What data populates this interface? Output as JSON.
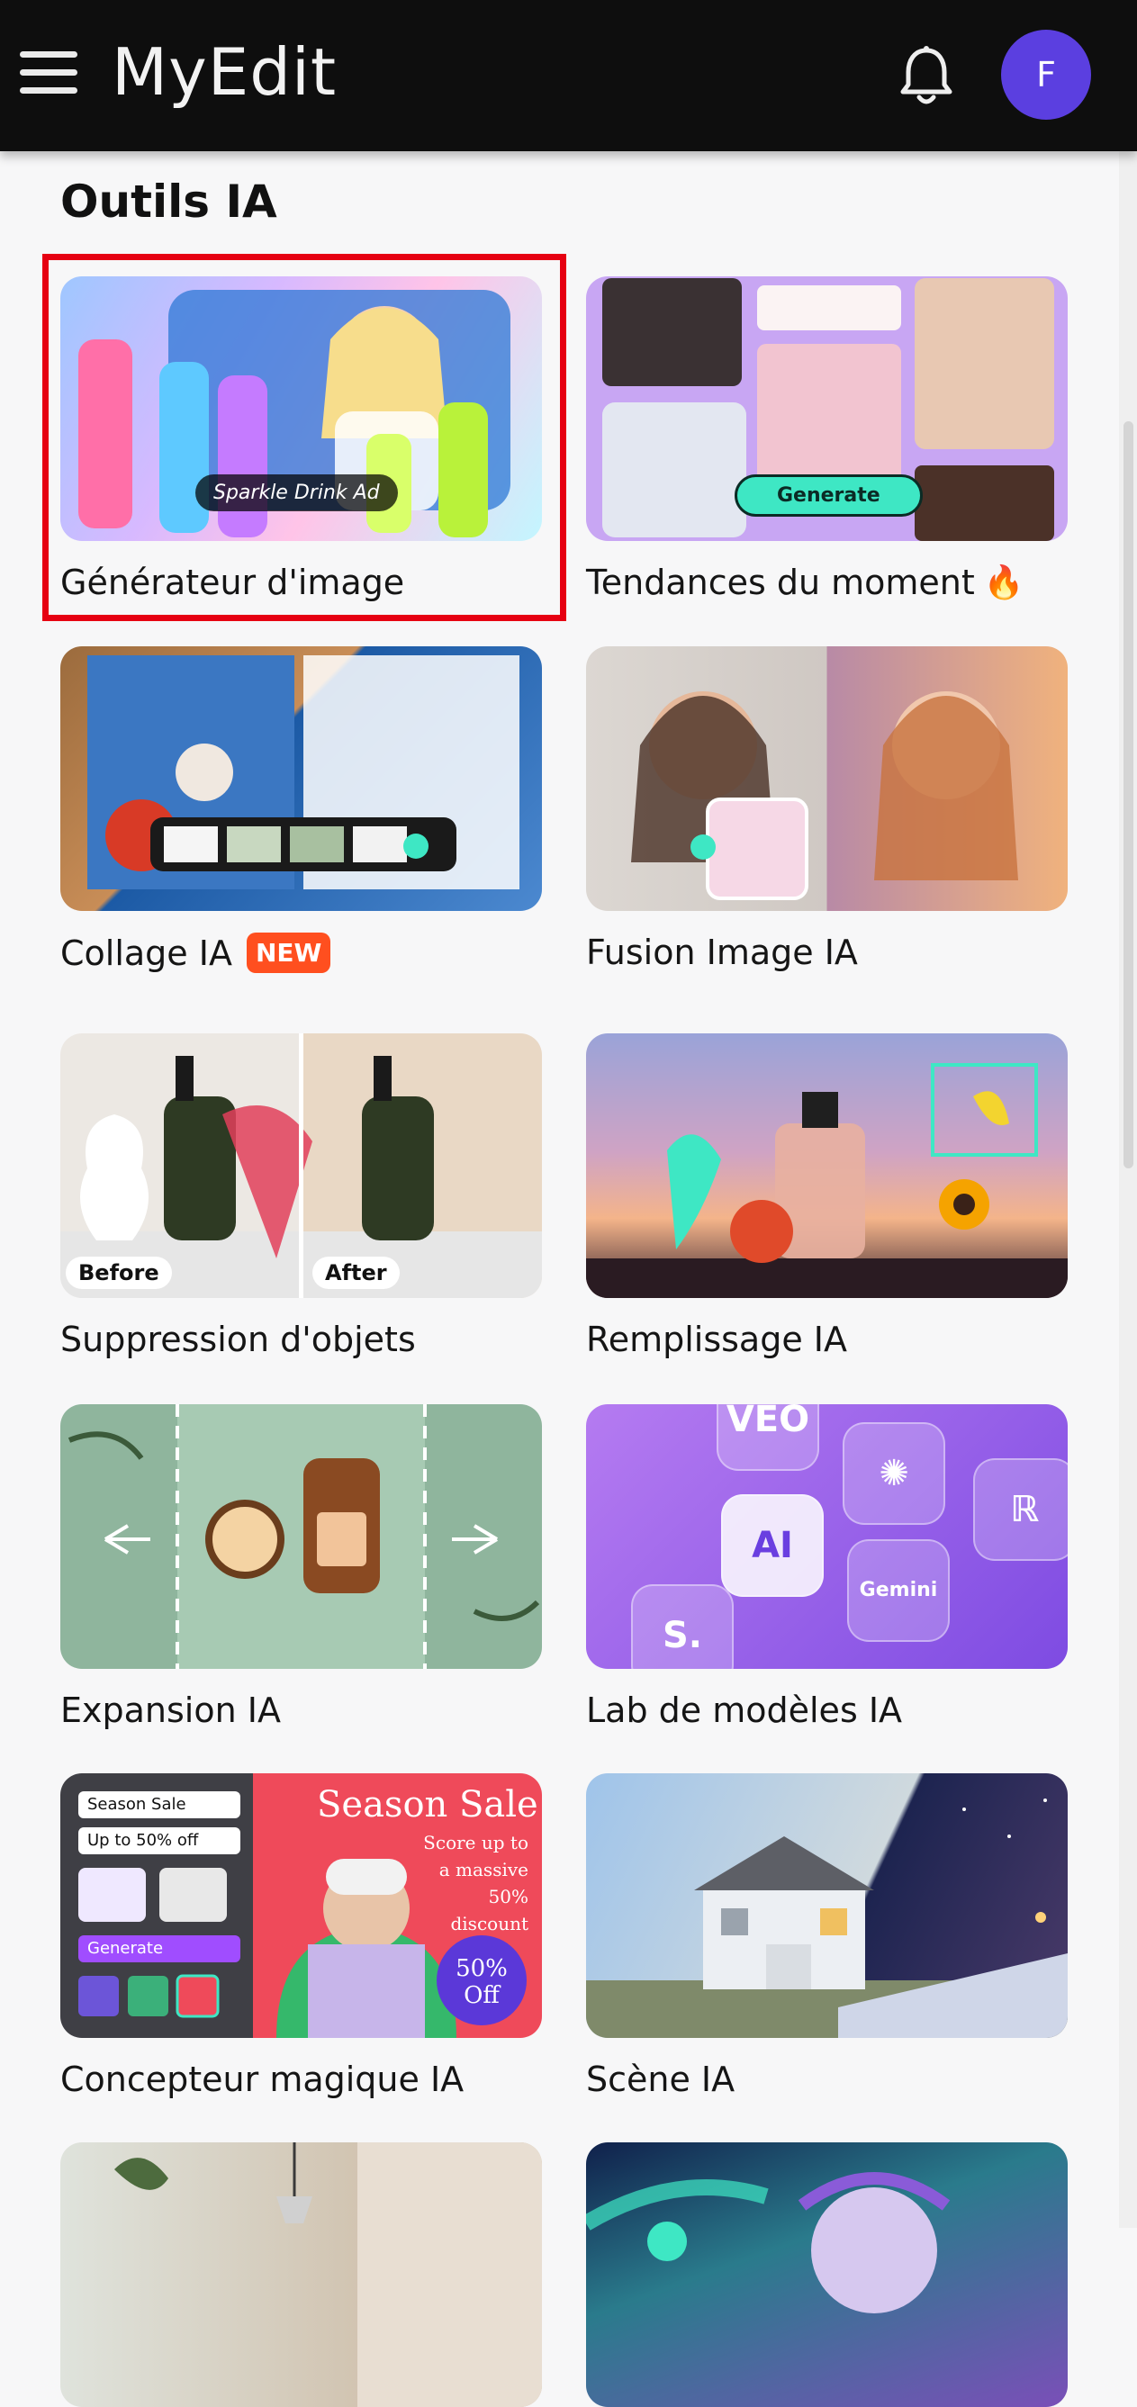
{
  "header": {
    "app_name": "MyEdit",
    "avatar_initial": "F",
    "menu_icon": "hamburger-menu-icon",
    "notification_icon": "bell-icon"
  },
  "section": {
    "title": "Outils IA"
  },
  "cards": [
    {
      "label": "Générateur d'image",
      "overlay": "Sparkle Drink Ad"
    },
    {
      "label": "Tendances du moment",
      "overlay": "Generate",
      "emoji": "🔥"
    },
    {
      "label": "Collage IA",
      "badge": "NEW"
    },
    {
      "label": "Fusion Image IA"
    },
    {
      "label": "Suppression d'objets",
      "before": "Before",
      "after": "After"
    },
    {
      "label": "Remplissage IA"
    },
    {
      "label": "Expansion IA"
    },
    {
      "label": "Lab de modèles IA",
      "tiles": [
        "VEO",
        "AI",
        "S.",
        "Gemini"
      ]
    },
    {
      "label": "Concepteur magique IA",
      "overlay_title": "Season Sale",
      "overlay_sub": "Score up to a massive 50% discount",
      "side_rows": [
        "Season Sale",
        "Up to 50% off"
      ],
      "side_button": "Generate",
      "discount": "50% Off"
    },
    {
      "label": "Scène IA"
    },
    {
      "label": ""
    },
    {
      "label": ""
    }
  ],
  "colors": {
    "header_bg": "#0e0e0e",
    "avatar_bg": "#5b3fe0",
    "badge_new": "#ff4f1f",
    "highlight_border": "#e60012",
    "accent_generate": "#3ee7c4"
  }
}
